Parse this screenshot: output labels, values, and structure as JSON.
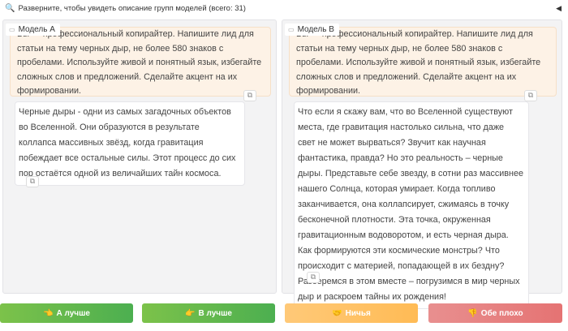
{
  "accordion": {
    "label": "Разверните, чтобы увидеть описание групп моделей (всего: 31)"
  },
  "model_a": {
    "label": "Модель A",
    "prompt": "Вы — профессиональный копирайтер. Напишите лид для статьи на тему черных дыр, не более 580 знаков с пробелами. Используйте живой и понятный язык, избегайте сложных слов и предложений. Сделайте акцент на их формировании.",
    "response": "Черные дыры - одни из самых загадочных объектов во Вселенной. Они образуются в результате коллапса массивных звёзд, когда гравитация побеждает все остальные силы. Этот процесс до сих пор остаётся одной из величайших тайн космоса."
  },
  "model_b": {
    "label": "Модель B",
    "prompt": "Вы — профессиональный копирайтер. Напишите лид для статьи на тему черных дыр, не более 580 знаков с пробелами. Используйте живой и понятный язык, избегайте сложных слов и предложений. Сделайте акцент на их формировании.",
    "response": "Что если я скажу вам, что во Вселенной существуют места, где гравитация настолько сильна, что даже свет не может вырваться? Звучит как научная фантастика, правда? Но это реальность – черные дыры. Представьте себе звезду, в сотни раз массивнее нашего Солнца, которая умирает. Когда топливо заканчивается, она коллапсирует, сжимаясь в точку бесконечной плотности. Эта точка, окруженная гравитационным водоворотом, и есть черная дыра. Как формируются эти космические монстры? Что происходит с материей, попадающей в их бездну? Разберемся в этом вместе – погрузимся в мир черных дыр и раскроем тайны их рождения!"
  },
  "buttons": [
    {
      "label": "А лучше",
      "icon": "👈",
      "color": "#62b848"
    },
    {
      "label": "В лучше",
      "icon": "👉",
      "color": "#62b848"
    },
    {
      "label": "Ничья",
      "icon": "🤝",
      "color": "#ffc566"
    },
    {
      "label": "Обе плохо",
      "icon": "👎",
      "color": "#e57f7f"
    }
  ]
}
